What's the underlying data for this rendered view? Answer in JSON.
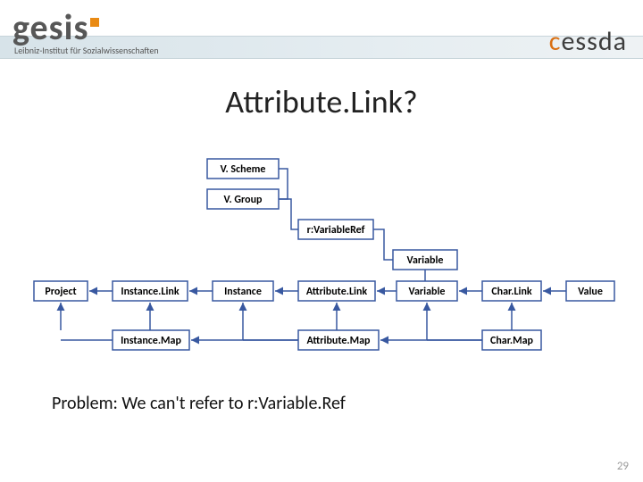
{
  "logos": {
    "gesis_word": "gesis",
    "gesis_sub": "Leibniz-Institut für Sozialwissenschaften",
    "cessda_html": "cessda"
  },
  "title": "Attribute.Link?",
  "nodes": {
    "vscheme": "V. Scheme",
    "vgroup": "V. Group",
    "rvarref": "r:VariableRef",
    "variable_top": "Variable",
    "project": "Project",
    "instancelink": "Instance.Link",
    "instance": "Instance",
    "attributelink": "Attribute.Link",
    "variable_row": "Variable",
    "charlink": "Char.Link",
    "value": "Value",
    "instancemap": "Instance.Map",
    "attributemap": "Attribute.Map",
    "charmap": "Char.Map"
  },
  "problem_text": "Problem: We can't refer to r:Variable.Ref",
  "slide_number": "29"
}
